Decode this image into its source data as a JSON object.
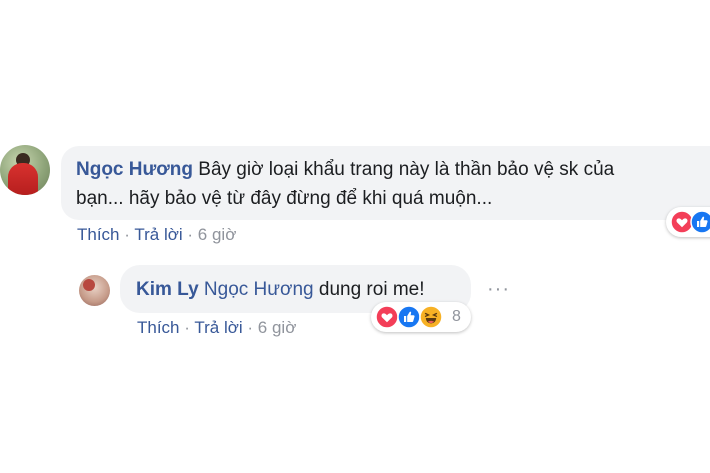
{
  "comment": {
    "author": "Ngọc Hương",
    "text_line1": "Bây giờ loại khẩu trang này là thần bảo vệ sk của",
    "text_line2": "bạn... hãy bảo vệ từ đây đừng để khi quá muộn...",
    "actions": {
      "like": "Thích",
      "sep1": "·",
      "reply": "Trả lời",
      "sep2": "·",
      "time": "6 giờ"
    },
    "reactions": [
      "love-reaction-icon",
      "like-reaction-icon"
    ]
  },
  "reply": {
    "author": "Kim Ly",
    "mention": "Ngọc Hương",
    "text": "dung roi me!",
    "more": "···",
    "actions": {
      "like": "Thích",
      "sep1": "·",
      "reply": "Trả lời",
      "sep2": "·",
      "time": "6 giờ"
    },
    "reactions": [
      "love-reaction-icon",
      "like-reaction-icon",
      "haha-reaction-icon"
    ],
    "reaction_count": "8"
  },
  "colors": {
    "link": "#385898",
    "bubble": "#f2f3f5",
    "muted": "#90949c",
    "love": "#f33e58",
    "like": "#1877f2",
    "haha": "#f7b125"
  }
}
